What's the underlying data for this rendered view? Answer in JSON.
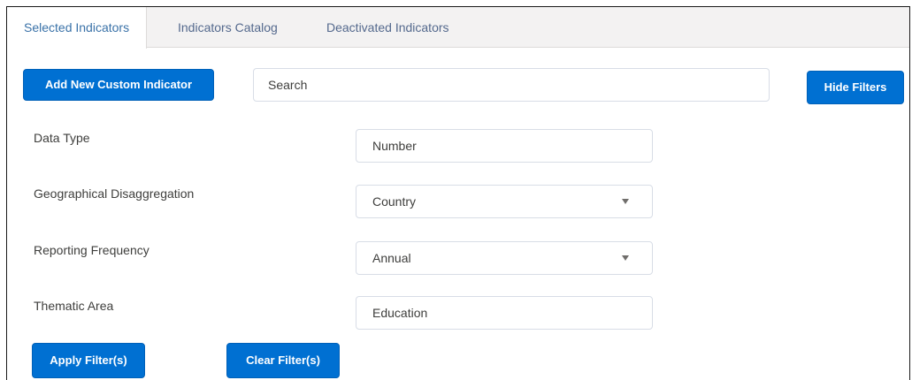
{
  "tabs": [
    {
      "label": "Selected Indicators",
      "active": true
    },
    {
      "label": "Indicators Catalog",
      "active": false
    },
    {
      "label": "Deactivated Indicators",
      "active": false
    }
  ],
  "toolbar": {
    "add_label": "Add New Custom Indicator",
    "search_placeholder": "Search",
    "hide_filters_label": "Hide Filters"
  },
  "filters": {
    "data_type": {
      "label": "Data Type",
      "value": "Number"
    },
    "geo": {
      "label": "Geographical Disaggregation",
      "value": "Country"
    },
    "frequency": {
      "label": "Reporting Frequency",
      "value": "Annual"
    },
    "thematic": {
      "label": "Thematic Area",
      "value": "Education"
    }
  },
  "actions": {
    "apply_label": "Apply Filter(s)",
    "clear_label": "Clear Filter(s)"
  },
  "colors": {
    "primary": "#0070d2",
    "tab_active_text": "#3a72a8",
    "tab_text": "#54698d"
  }
}
